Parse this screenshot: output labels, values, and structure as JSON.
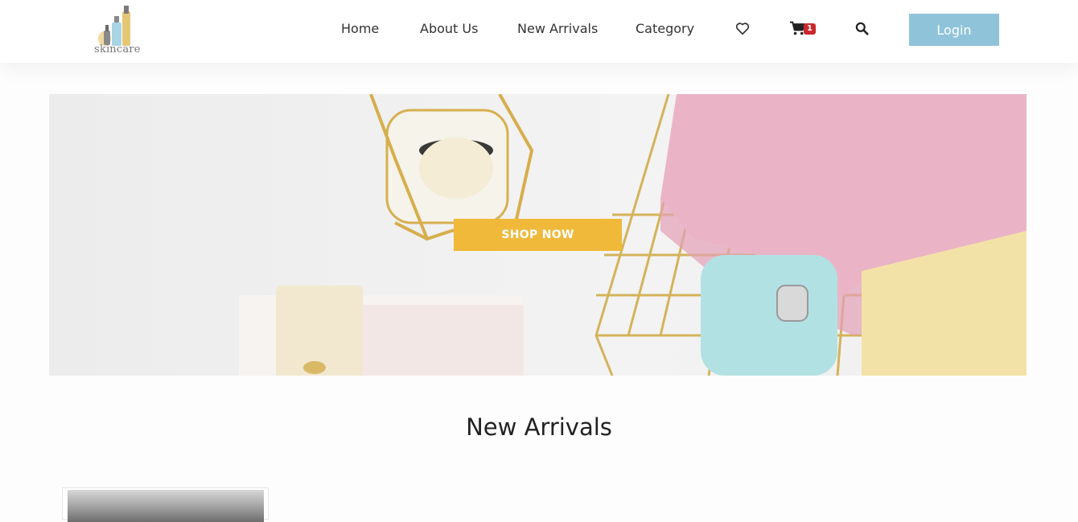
{
  "brand": {
    "logo_text": "skincare"
  },
  "nav": {
    "items": [
      {
        "label": "Home"
      },
      {
        "label": "About Us"
      },
      {
        "label": "New Arrivals"
      },
      {
        "label": "Category"
      }
    ],
    "wishlist_icon": "heart-icon",
    "cart_icon": "cart-icon",
    "cart_count": "1",
    "search_icon": "search-icon",
    "login_label": "Login"
  },
  "hero": {
    "cta_label": "SHOP NOW"
  },
  "new_arrivals": {
    "title": "New Arrivals"
  },
  "colors": {
    "accent": "#f0b93a",
    "login": "#8fc3d9",
    "badge": "#c9282d"
  }
}
